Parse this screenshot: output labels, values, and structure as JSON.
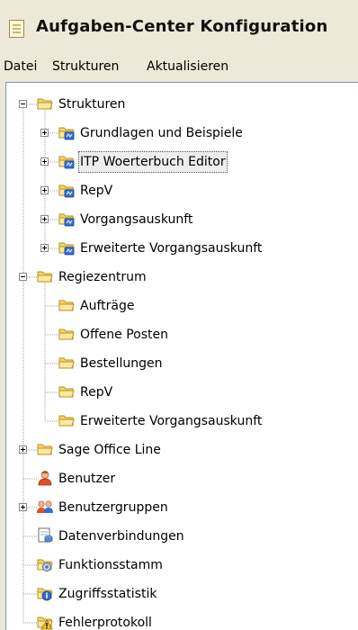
{
  "window": {
    "title": "Aufgaben-Center Konfiguration",
    "icon": "notepad-icon"
  },
  "menu": [
    {
      "label": "Datei"
    },
    {
      "label": "Strukturen"
    },
    {
      "label": "Aktualisieren"
    }
  ],
  "tree": [
    {
      "label": "Strukturen",
      "depth": 0,
      "expander": "minus",
      "icon": "folder-icon",
      "children_follow": true
    },
    {
      "label": "Grundlagen und Beispiele",
      "depth": 1,
      "expander": "plus",
      "icon": "shared-folder-icon"
    },
    {
      "label": "ITP Woerterbuch Editor",
      "depth": 1,
      "expander": "plus",
      "icon": "shared-folder-icon",
      "selected": true
    },
    {
      "label": "RepV",
      "depth": 1,
      "expander": "plus",
      "icon": "shared-folder-icon"
    },
    {
      "label": "Vorgangsauskunft",
      "depth": 1,
      "expander": "plus",
      "icon": "shared-folder-icon"
    },
    {
      "label": "Erweiterte Vorgangsauskunft",
      "depth": 1,
      "expander": "plus",
      "icon": "shared-folder-icon"
    },
    {
      "label": "Regiezentrum",
      "depth": 0,
      "expander": "minus",
      "icon": "folder-icon"
    },
    {
      "label": "Aufträge",
      "depth": 1,
      "expander": "none",
      "icon": "folder-icon"
    },
    {
      "label": "Offene Posten",
      "depth": 1,
      "expander": "none",
      "icon": "folder-icon"
    },
    {
      "label": "Bestellungen",
      "depth": 1,
      "expander": "none",
      "icon": "folder-icon"
    },
    {
      "label": "RepV",
      "depth": 1,
      "expander": "none",
      "icon": "folder-icon"
    },
    {
      "label": "Erweiterte Vorgangsauskunft",
      "depth": 1,
      "expander": "none",
      "icon": "folder-icon"
    },
    {
      "label": "Sage Office Line",
      "depth": 0,
      "expander": "plus",
      "icon": "folder-icon"
    },
    {
      "label": "Benutzer",
      "depth": 0,
      "expander": "none",
      "icon": "user-icon"
    },
    {
      "label": "Benutzergruppen",
      "depth": 0,
      "expander": "plus",
      "icon": "user-group-icon"
    },
    {
      "label": "Datenverbindungen",
      "depth": 0,
      "expander": "none",
      "icon": "data-connection-icon"
    },
    {
      "label": "Funktionsstamm",
      "depth": 0,
      "expander": "none",
      "icon": "function-folder-icon"
    },
    {
      "label": "Zugriffsstatistik",
      "depth": 0,
      "expander": "none",
      "icon": "info-folder-icon"
    },
    {
      "label": "Fehlerprotokoll",
      "depth": 0,
      "expander": "none",
      "icon": "warning-folder-icon"
    }
  ],
  "colors": {
    "folder": "#f6d86a",
    "shared_badge": "#2f6fd8",
    "selection": "#eeeeee"
  }
}
